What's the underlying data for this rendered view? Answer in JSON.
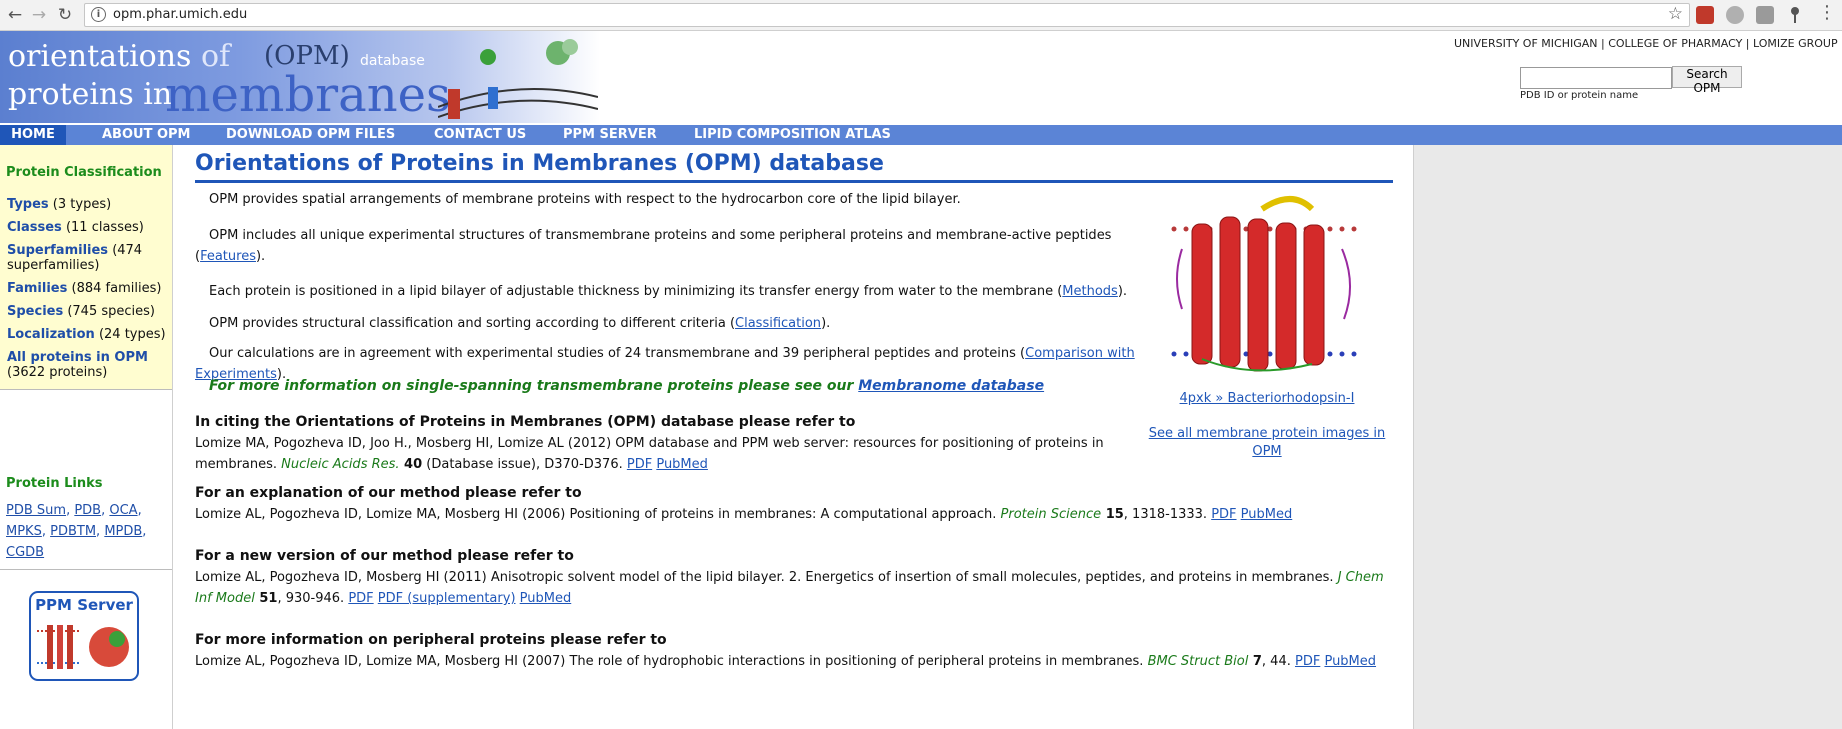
{
  "browser": {
    "url": "opm.phar.umich.edu",
    "back_icon": "arrow-left-icon",
    "forward_icon": "arrow-right-icon",
    "reload_icon": "reload-icon"
  },
  "banner": {
    "line1_a": "orientations ",
    "line1_b": "of",
    "line2": "proteins in",
    "big": "membranes",
    "opm": "(OPM)",
    "database": "database"
  },
  "toplinks": "UNIVERSITY OF MICHIGAN  |  COLLEGE OF PHARMACY  |  LOMIZE GROUP",
  "search": {
    "value": "",
    "button": "Search OPM",
    "hint": "PDB ID or protein name"
  },
  "nav": [
    "HOME",
    "ABOUT OPM",
    "DOWNLOAD OPM FILES",
    "CONTACT US",
    "PPM SERVER",
    "LIPID COMPOSITION ATLAS"
  ],
  "sidebar": {
    "classification_title": "Protein Classification",
    "items": [
      {
        "k": "Types",
        "v": " (3 types)"
      },
      {
        "k": "Classes",
        "v": " (11 classes)"
      },
      {
        "k": "Superfamilies",
        "v": " (474 superfamilies)"
      },
      {
        "k": "Families",
        "v": " (884 families)"
      },
      {
        "k": "Species",
        "v": " (745 species)"
      },
      {
        "k": "Localization",
        "v": " (24 types)"
      },
      {
        "k": "All proteins in OPM",
        "v": " (3622 proteins)"
      }
    ],
    "links_title": "Protein Links",
    "links": [
      "PDB Sum",
      "PDB",
      "OCA",
      "MPKS",
      "PDBTM",
      "MPDB",
      "CGDB"
    ],
    "ppm_title": "PPM Server"
  },
  "main": {
    "title": "Orientations of Proteins in Membranes (OPM) database",
    "p1": "OPM provides spatial arrangements of membrane proteins with respect to the hydrocarbon core of the lipid bilayer.",
    "p2_a": "OPM includes all unique experimental structures of transmembrane proteins and some peripheral proteins and membrane-active peptides",
    "p2_link": "Features",
    "p3_a": "Each protein is positioned in a lipid bilayer of adjustable thickness by minimizing its transfer energy from water to the membrane (",
    "p3_link": "Methods",
    "p4_a": "OPM provides structural classification and sorting according to different criteria (",
    "p4_link": "Classification",
    "p5_a": "Our calculations are in agreement with experimental studies of 24 transmembrane and 39 peripheral peptides and proteins (",
    "p5_link1": "Comparison with",
    "p5_link2": "Experiments",
    "note_a": "For more information on single-spanning transmembrane proteins please see our ",
    "note_link": "Membranome database",
    "h1": "In citing the Orientations of Proteins in Membranes (OPM) database please refer to",
    "c1_a": "Lomize MA, Pogozheva ID, Joo H., Mosberg HI, Lomize AL (2012) OPM database and PPM web server: resources for positioning of proteins in",
    "c1_b": "membranes. ",
    "c1_j": "Nucleic Acids Res.",
    "c1_v": " 40",
    "c1_c": " (Database issue), D370-D376. ",
    "h2": "For an explanation of our method please refer to",
    "c2_a": "Lomize AL, Pogozheva ID, Lomize MA, Mosberg HI (2006) Positioning of proteins in membranes: A computational approach. ",
    "c2_j": "Protein Science",
    "c2_v": " 15",
    "c2_c": ", 1318-1333. ",
    "h3": "For a new version of our method please refer to",
    "c3_a": "Lomize AL, Pogozheva ID, Mosberg HI (2011) Anisotropic solvent model of the lipid bilayer. 2. Energetics of insertion of small molecules, peptides, and proteins in membranes. ",
    "c3_j1": "J Chem",
    "c3_j2": "Inf Model",
    "c3_v": " 51",
    "c3_c": ", 930-946. ",
    "pdf_supp": "PDF (supplementary)",
    "h4": "For more information on peripheral proteins please refer to",
    "c4_a": "Lomize AL, Pogozheva ID, Lomize MA, Mosberg HI (2007) The role of hydrophobic interactions in positioning of peripheral proteins in membranes. ",
    "c4_j": "BMC Struct Biol",
    "c4_v": " 7",
    "c4_c": ", 44. ",
    "pdf": "PDF",
    "pubmed": "PubMed",
    "image_caption": "4pxk » Bacteriorhodopsin-I",
    "see_all_1": "See all membrane protein images in",
    "see_all_2": "OPM"
  },
  "colors": {
    "nav_bg": "#5b84d6",
    "nav_active": "#1f56b8",
    "sidebar_bg": "#fffdd0",
    "heading_green": "#1c8c1c",
    "link_blue": "#1f56b8"
  }
}
